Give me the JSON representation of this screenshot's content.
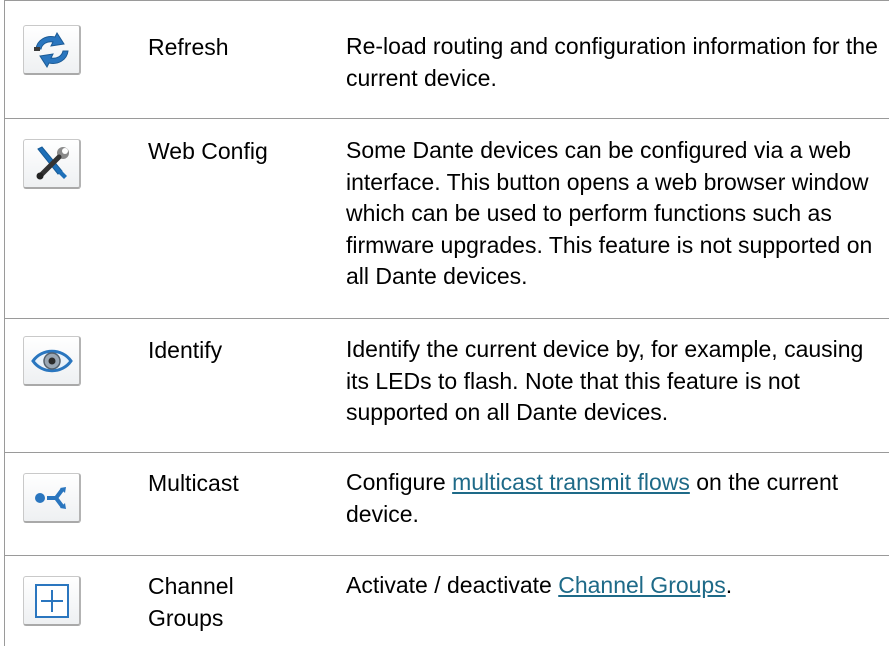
{
  "rows": [
    {
      "icon": "refresh-icon",
      "name": "Refresh",
      "desc": "Re-load routing and configuration information for the current device."
    },
    {
      "icon": "web-config-icon",
      "name": "Web Config",
      "desc": "Some Dante devices can be configured via a web interface. This button opens a web browser window which can be used to perform functions such as firmware upgrades. This feature is not supported on all Dante devices."
    },
    {
      "icon": "identify-eye-icon",
      "name": "Identify",
      "desc": "Identify the current device by, for example, causing its LEDs to flash. Note that this feature is not supported on all Dante devices."
    },
    {
      "icon": "multicast-icon",
      "name": "Multicast",
      "desc_pre": "Configure ",
      "desc_link": "multicast transmit flows",
      "desc_post": " on the current device."
    },
    {
      "icon": "channel-groups-icon",
      "name_line1": "Channel",
      "name_line2": "Groups",
      "desc_pre": "Activate / deactivate ",
      "desc_link": "Channel Groups",
      "desc_post": "."
    }
  ],
  "colors": {
    "border": "#9a9a9a",
    "link": "#1e6a88",
    "icon_blue": "#1d6fb8"
  }
}
